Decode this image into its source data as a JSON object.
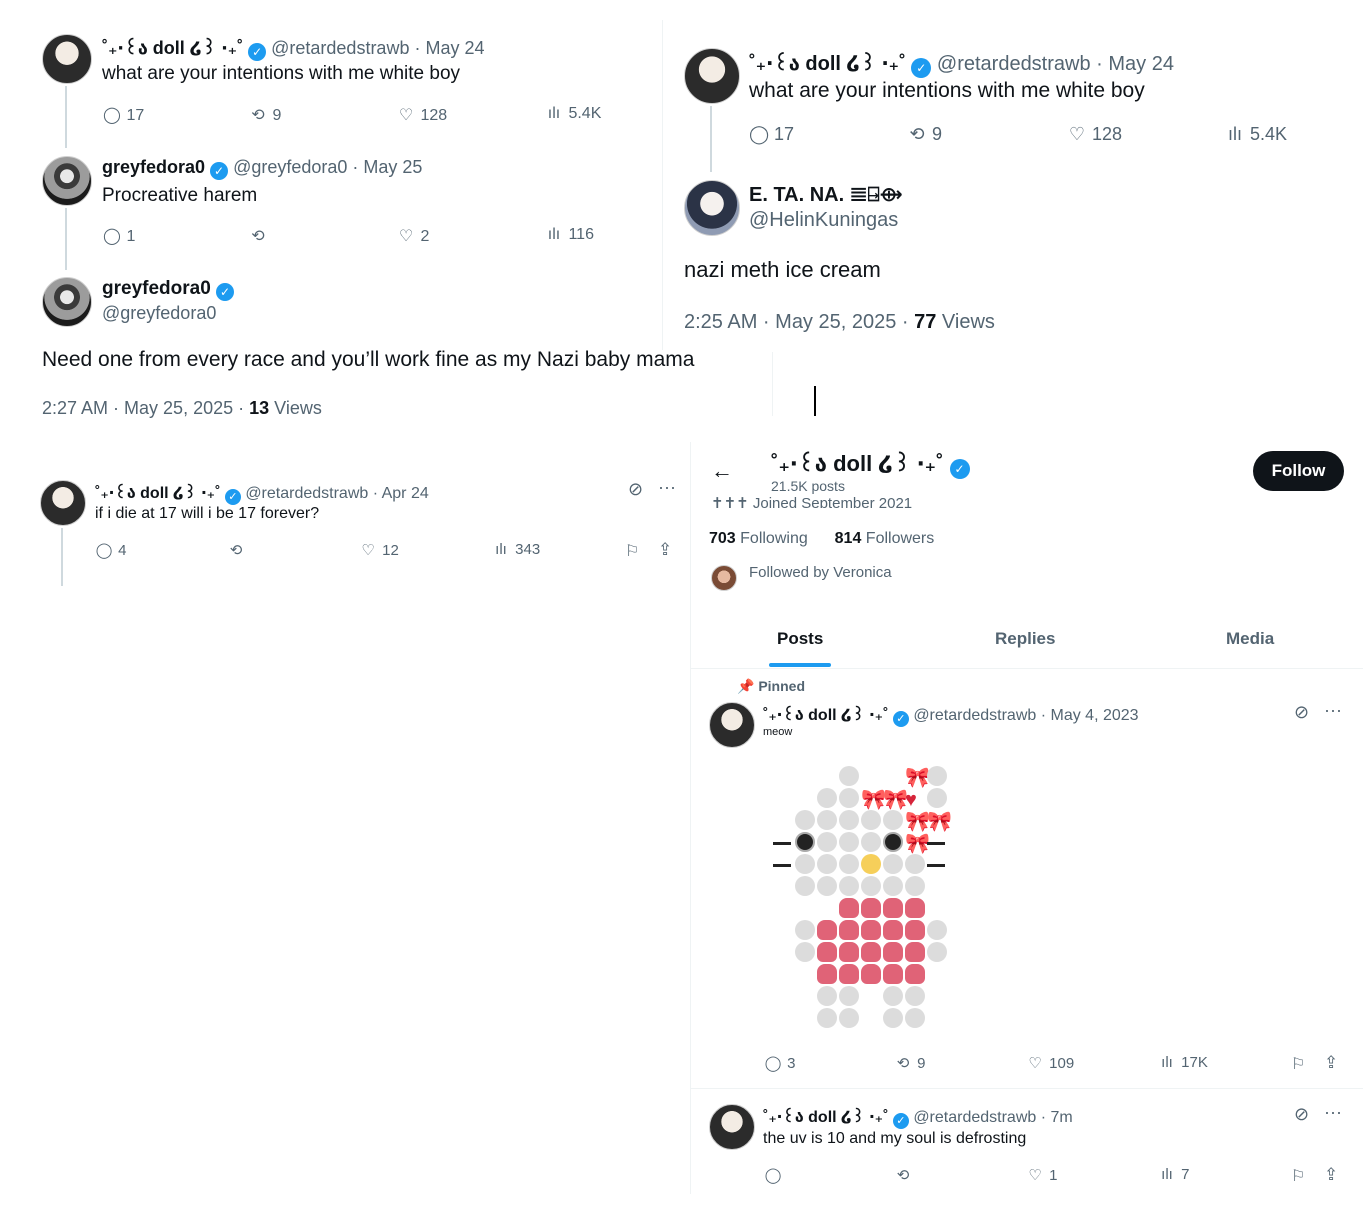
{
  "p1": {
    "t1": {
      "name": "˚₊‧꒰ა doll ໒꒱ ‧₊˚",
      "handle": "@retardedstrawb · May 24",
      "text": "what are your intentions with me white boy",
      "replies": "17",
      "reposts": "9",
      "likes": "128",
      "views": "5.4K"
    },
    "t2": {
      "name": "greyfedora0",
      "handle": "@greyfedora0 · May 25",
      "text": "Procreative harem",
      "replies": "1",
      "reposts": "",
      "likes": "2",
      "views": "116"
    },
    "t3": {
      "name": "greyfedora0",
      "handle": "@greyfedora0",
      "text": "Need one from every race and you’ll work fine as my Nazi baby mama",
      "time": "2:27 AM · May 25, 2025 · ",
      "views_num": "13",
      "views_label": " Views"
    }
  },
  "p2": {
    "t1": {
      "name": "˚₊‧꒰ა doll ໒꒱ ‧₊˚",
      "handle": "@retardedstrawb · May 24",
      "text": "what are your intentions with me white boy",
      "replies": "17",
      "reposts": "9",
      "likes": "128",
      "views": "5.4K"
    },
    "t2": {
      "name": "E. TA. NA. 𝌆⍈⟴",
      "handle": "@HelinKuningas",
      "text": "nazi meth ice cream",
      "time": "2:25 AM · May 25, 2025 · ",
      "views_num": "77",
      "views_label": " Views"
    }
  },
  "p3": {
    "t1": {
      "name": "˚₊‧꒰ა doll ໒꒱ ‧₊˚",
      "handle": "@retardedstrawb · Apr 24",
      "text": "if i die at 17 will i be 17 forever?",
      "replies": "4",
      "reposts": "",
      "likes": "12",
      "views": "343"
    }
  },
  "p4": {
    "header": {
      "name": "˚₊‧꒰ა doll ໒꒱ ‧₊˚",
      "posts": "21.5K posts",
      "follow": "Follow",
      "meta": "✝✝✝   Joined September 2021"
    },
    "following_num": "703",
    "following_label": " Following",
    "followers_num": "814",
    "followers_label": " Followers",
    "followed_by": "Followed by Veronica",
    "tabs": [
      "Posts",
      "Replies",
      "Media"
    ],
    "pinned": "Pinned",
    "post1": {
      "name": "˚₊‧꒰ა doll ໒꒱ ‧₊˚",
      "handle": "@retardedstrawb · May 4, 2023",
      "text": "meow",
      "replies": "3",
      "reposts": "9",
      "likes": "109",
      "views": "17K"
    },
    "post2": {
      "name": "˚₊‧꒰ა doll ໒꒱ ‧₊˚",
      "handle": "@retardedstrawb · 7m",
      "text": "the uv is 10 and my soul is defrosting",
      "replies": "",
      "reposts": "",
      "likes": "1",
      "views": "7"
    }
  },
  "icons": {
    "reply": "💬",
    "repost": "⟲",
    "like": "♡",
    "views": "📊",
    "bookmark": "🔖",
    "share": "⇪",
    "more": "···",
    "grok": "⊘",
    "back": "←",
    "pin": "📌",
    "location": "⊚",
    "calendar": "▦"
  },
  "colors": {
    "accent": "#1d9bf0",
    "text": "#0f1419",
    "muted": "#536471"
  }
}
